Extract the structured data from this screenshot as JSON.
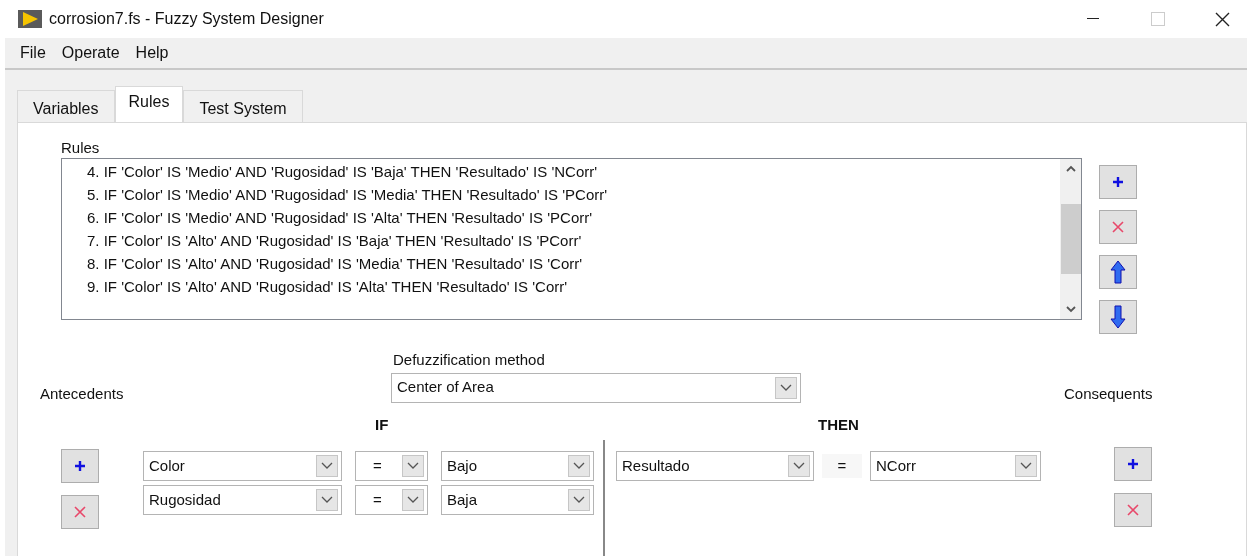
{
  "window": {
    "title": "corrosion7.fs - Fuzzy System Designer"
  },
  "menu": [
    "File",
    "Operate",
    "Help"
  ],
  "tabs": [
    {
      "label": "Variables",
      "selected": false
    },
    {
      "label": "Rules",
      "selected": true
    },
    {
      "label": "Test System",
      "selected": false
    }
  ],
  "rules": {
    "label": "Rules",
    "items": [
      "4. IF 'Color' IS 'Medio' AND 'Rugosidad' IS 'Baja' THEN 'Resultado' IS 'NCorr'",
      "5. IF 'Color' IS 'Medio' AND 'Rugosidad' IS 'Media' THEN 'Resultado' IS 'PCorr'",
      "6. IF 'Color' IS 'Medio' AND 'Rugosidad' IS 'Alta' THEN 'Resultado' IS 'PCorr'",
      "7. IF 'Color' IS 'Alto' AND 'Rugosidad' IS 'Baja' THEN 'Resultado' IS 'PCorr'",
      "8. IF 'Color' IS 'Alto' AND 'Rugosidad' IS 'Media' THEN 'Resultado' IS 'Corr'",
      "9. IF 'Color' IS 'Alto' AND 'Rugosidad' IS 'Alta' THEN 'Resultado' IS 'Corr'"
    ]
  },
  "defuzzification": {
    "label": "Defuzzification method",
    "value": "Center of Area"
  },
  "antecedents": {
    "label": "Antecedents",
    "heading": "IF",
    "rows": [
      {
        "variable": "Color",
        "operator": "=",
        "value": "Bajo"
      },
      {
        "variable": "Rugosidad",
        "operator": "=",
        "value": "Baja"
      }
    ]
  },
  "consequents": {
    "label": "Consequents",
    "heading": "THEN",
    "rows": [
      {
        "variable": "Resultado",
        "operator": "=",
        "value": "NCorr"
      }
    ]
  }
}
